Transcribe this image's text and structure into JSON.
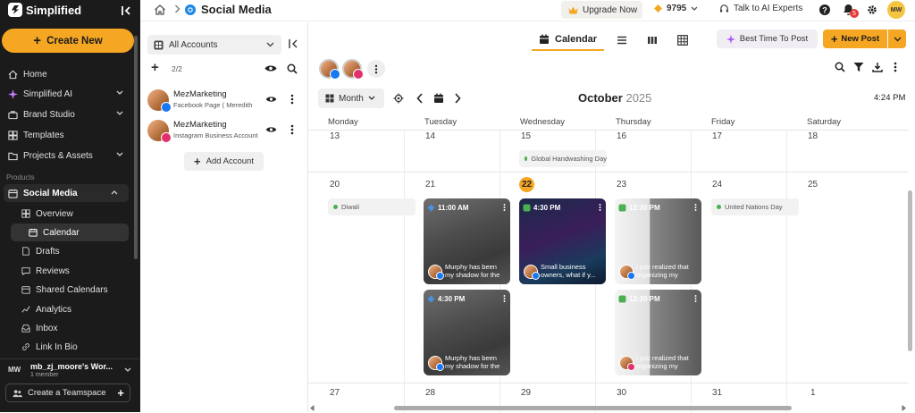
{
  "sidebar": {
    "brand": "Simplified",
    "create_label": "Create New",
    "nav": [
      {
        "label": "Home"
      },
      {
        "label": "Simplified AI"
      },
      {
        "label": "Brand Studio"
      },
      {
        "label": "Templates"
      },
      {
        "label": "Projects & Assets"
      }
    ],
    "products_label": "Products",
    "social_media": "Social Media",
    "sub_items": [
      {
        "label": "Overview"
      },
      {
        "label": "Calendar"
      },
      {
        "label": "Drafts"
      },
      {
        "label": "Reviews"
      },
      {
        "label": "Shared Calendars"
      },
      {
        "label": "Analytics"
      },
      {
        "label": "Inbox"
      },
      {
        "label": "Link In Bio"
      }
    ],
    "workspace": {
      "initials": "MW",
      "name": "mb_zj_moore's Wor...",
      "members": "1 member"
    },
    "team_label": "Create a Teamspace"
  },
  "topbar": {
    "title": "Social Media",
    "upgrade": "Upgrade Now",
    "credits": "9795",
    "talk": "Talk to AI Experts",
    "notifications": "5",
    "avatar": "MW"
  },
  "accounts": {
    "selector": "All Accounts",
    "count": "2/2",
    "list": [
      {
        "name": "MezMarketing",
        "sub": "Facebook Page ( Meredith",
        "network": "facebook"
      },
      {
        "name": "MezMarketing",
        "sub": "Instagram Business Account",
        "network": "instagram"
      }
    ],
    "add_label": "Add Account"
  },
  "main": {
    "view_calendar": "Calendar",
    "best_time": "Best Time To Post",
    "new_post": "New Post",
    "month_btn": "Month",
    "month": "October",
    "year": "2025",
    "time": "4:24 PM",
    "days": [
      "Monday",
      "Tuesday",
      "Wednesday",
      "Thursday",
      "Friday",
      "Saturday"
    ],
    "week1": [
      "13",
      "14",
      "15",
      "16",
      "17",
      "18"
    ],
    "week2": [
      "20",
      "21",
      "22",
      "23",
      "24",
      "25"
    ],
    "week3": [
      "27",
      "28",
      "29",
      "30",
      "31",
      "1"
    ],
    "events": {
      "global_handwashing": "Global Handwashing Day",
      "diwali": "Diwali",
      "un_day": "United Nations Day"
    },
    "posts": [
      {
        "time": "11:00 AM",
        "text": "Murphy has been my shadow for the",
        "network": "facebook"
      },
      {
        "time": "4:30 PM",
        "text": "Murphy has been my shadow for the",
        "network": "facebook"
      },
      {
        "time": "4:30 PM",
        "text": "Small business owners, what if y...",
        "network": "facebook"
      },
      {
        "time": "12:30 PM",
        "text": "I just realized that organizing my",
        "network": "facebook"
      },
      {
        "time": "12:30 PM",
        "text": "I just realized that organizing my",
        "network": "instagram"
      }
    ]
  },
  "colors": {
    "accent": "#f5a623",
    "sidebar_bg": "#1b1b1b",
    "facebook": "#1877f2",
    "instagram": "#e1306c"
  }
}
